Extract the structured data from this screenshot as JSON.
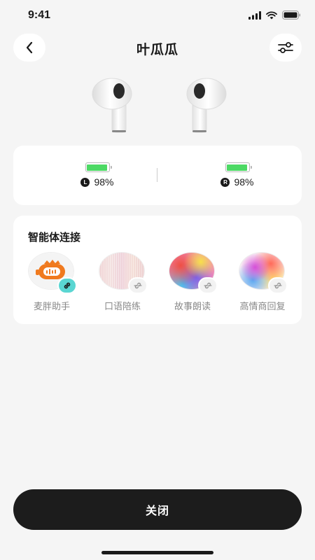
{
  "status_bar": {
    "time": "9:41"
  },
  "header": {
    "title": "叶瓜瓜"
  },
  "battery": {
    "left": {
      "badge": "L",
      "percent": "98%",
      "level": 0.98
    },
    "right": {
      "badge": "R",
      "percent": "98%",
      "level": 0.98
    },
    "fill_color": "#4cd964"
  },
  "agents": {
    "title": "智能体连接",
    "items": [
      {
        "label": "麦胖助手",
        "connected": true
      },
      {
        "label": "口语陪练",
        "connected": false
      },
      {
        "label": "故事朗读",
        "connected": false
      },
      {
        "label": "高情商回复",
        "connected": false
      }
    ]
  },
  "footer": {
    "close_label": "关闭"
  },
  "colors": {
    "accent_teal": "#5ad6d2",
    "brand_orange": "#f07a1f",
    "primary_dark": "#1c1c1c"
  }
}
